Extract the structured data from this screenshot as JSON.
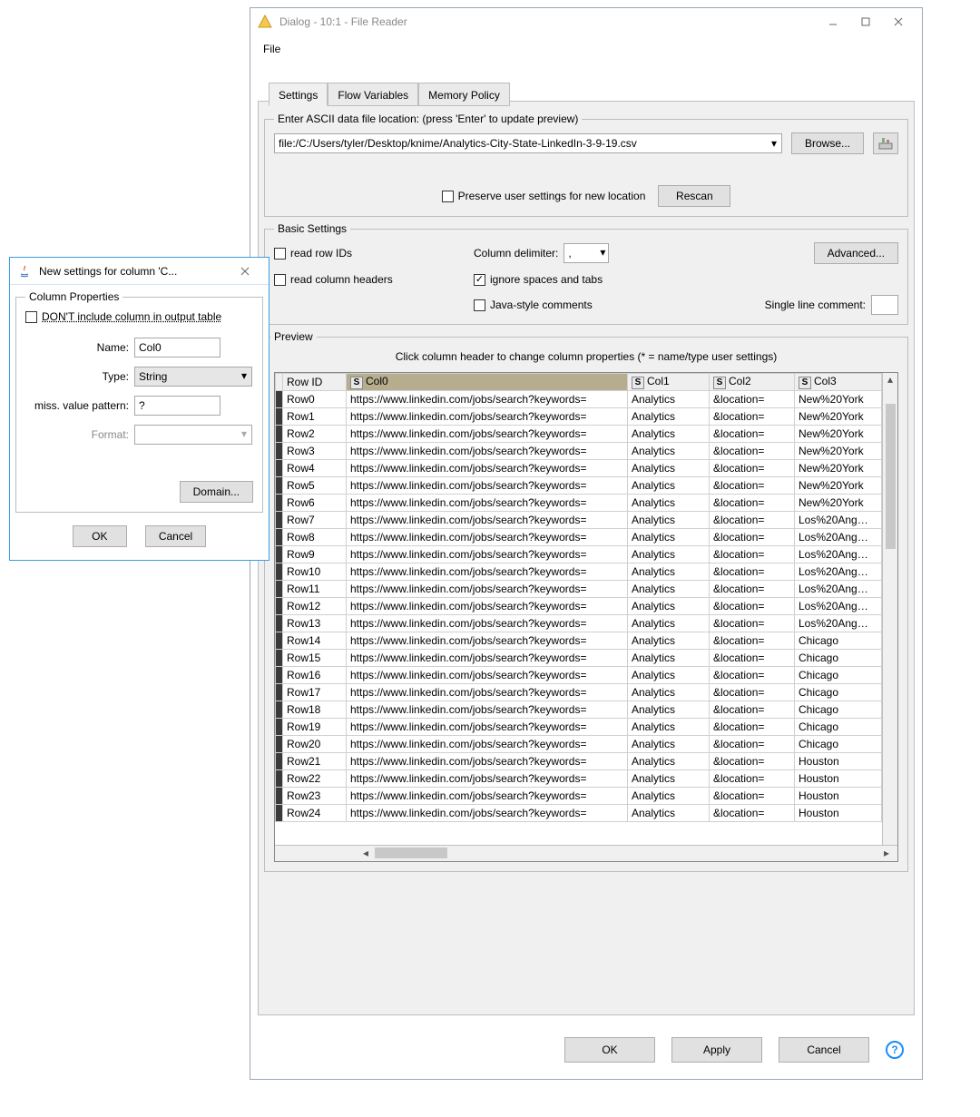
{
  "main": {
    "title": "Dialog - 10:1 - File Reader",
    "menu": {
      "file": "File"
    },
    "tabs": [
      "Settings",
      "Flow Variables",
      "Memory Policy"
    ],
    "location": {
      "legend": "Enter ASCII data file location: (press 'Enter' to update preview)",
      "path": "file:/C:/Users/tyler/Desktop/knime/Analytics-City-State-LinkedIn-3-9-19.csv",
      "browse": "Browse...",
      "preserve": "Preserve user settings for new location",
      "rescan": "Rescan"
    },
    "basic": {
      "legend": "Basic Settings",
      "readRowIds": "read row IDs",
      "readColHeaders": "read column headers",
      "colDelimLabel": "Column delimiter:",
      "colDelimValue": ",",
      "ignoreSpaces": "ignore spaces and tabs",
      "javaComments": "Java-style comments",
      "singleLine": "Single line comment:",
      "advanced": "Advanced..."
    },
    "preview": {
      "legend": "Preview",
      "hint": "Click column header to change column properties (* = name/type user settings)",
      "headers": {
        "rowid": "Row ID",
        "c0": "Col0",
        "c1": "Col1",
        "c2": "Col2",
        "c3": "Col3"
      },
      "rows": [
        {
          "id": "Row0",
          "c0": "https://www.linkedin.com/jobs/search?keywords=",
          "c1": "Analytics",
          "c2": "&location=",
          "c3": "New%20York"
        },
        {
          "id": "Row1",
          "c0": "https://www.linkedin.com/jobs/search?keywords=",
          "c1": "Analytics",
          "c2": "&location=",
          "c3": "New%20York"
        },
        {
          "id": "Row2",
          "c0": "https://www.linkedin.com/jobs/search?keywords=",
          "c1": "Analytics",
          "c2": "&location=",
          "c3": "New%20York"
        },
        {
          "id": "Row3",
          "c0": "https://www.linkedin.com/jobs/search?keywords=",
          "c1": "Analytics",
          "c2": "&location=",
          "c3": "New%20York"
        },
        {
          "id": "Row4",
          "c0": "https://www.linkedin.com/jobs/search?keywords=",
          "c1": "Analytics",
          "c2": "&location=",
          "c3": "New%20York"
        },
        {
          "id": "Row5",
          "c0": "https://www.linkedin.com/jobs/search?keywords=",
          "c1": "Analytics",
          "c2": "&location=",
          "c3": "New%20York"
        },
        {
          "id": "Row6",
          "c0": "https://www.linkedin.com/jobs/search?keywords=",
          "c1": "Analytics",
          "c2": "&location=",
          "c3": "New%20York"
        },
        {
          "id": "Row7",
          "c0": "https://www.linkedin.com/jobs/search?keywords=",
          "c1": "Analytics",
          "c2": "&location=",
          "c3": "Los%20Ang…"
        },
        {
          "id": "Row8",
          "c0": "https://www.linkedin.com/jobs/search?keywords=",
          "c1": "Analytics",
          "c2": "&location=",
          "c3": "Los%20Ang…"
        },
        {
          "id": "Row9",
          "c0": "https://www.linkedin.com/jobs/search?keywords=",
          "c1": "Analytics",
          "c2": "&location=",
          "c3": "Los%20Ang…"
        },
        {
          "id": "Row10",
          "c0": "https://www.linkedin.com/jobs/search?keywords=",
          "c1": "Analytics",
          "c2": "&location=",
          "c3": "Los%20Ang…"
        },
        {
          "id": "Row11",
          "c0": "https://www.linkedin.com/jobs/search?keywords=",
          "c1": "Analytics",
          "c2": "&location=",
          "c3": "Los%20Ang…"
        },
        {
          "id": "Row12",
          "c0": "https://www.linkedin.com/jobs/search?keywords=",
          "c1": "Analytics",
          "c2": "&location=",
          "c3": "Los%20Ang…"
        },
        {
          "id": "Row13",
          "c0": "https://www.linkedin.com/jobs/search?keywords=",
          "c1": "Analytics",
          "c2": "&location=",
          "c3": "Los%20Ang…"
        },
        {
          "id": "Row14",
          "c0": "https://www.linkedin.com/jobs/search?keywords=",
          "c1": "Analytics",
          "c2": "&location=",
          "c3": "Chicago"
        },
        {
          "id": "Row15",
          "c0": "https://www.linkedin.com/jobs/search?keywords=",
          "c1": "Analytics",
          "c2": "&location=",
          "c3": "Chicago"
        },
        {
          "id": "Row16",
          "c0": "https://www.linkedin.com/jobs/search?keywords=",
          "c1": "Analytics",
          "c2": "&location=",
          "c3": "Chicago"
        },
        {
          "id": "Row17",
          "c0": "https://www.linkedin.com/jobs/search?keywords=",
          "c1": "Analytics",
          "c2": "&location=",
          "c3": "Chicago"
        },
        {
          "id": "Row18",
          "c0": "https://www.linkedin.com/jobs/search?keywords=",
          "c1": "Analytics",
          "c2": "&location=",
          "c3": "Chicago"
        },
        {
          "id": "Row19",
          "c0": "https://www.linkedin.com/jobs/search?keywords=",
          "c1": "Analytics",
          "c2": "&location=",
          "c3": "Chicago"
        },
        {
          "id": "Row20",
          "c0": "https://www.linkedin.com/jobs/search?keywords=",
          "c1": "Analytics",
          "c2": "&location=",
          "c3": "Chicago"
        },
        {
          "id": "Row21",
          "c0": "https://www.linkedin.com/jobs/search?keywords=",
          "c1": "Analytics",
          "c2": "&location=",
          "c3": "Houston"
        },
        {
          "id": "Row22",
          "c0": "https://www.linkedin.com/jobs/search?keywords=",
          "c1": "Analytics",
          "c2": "&location=",
          "c3": "Houston"
        },
        {
          "id": "Row23",
          "c0": "https://www.linkedin.com/jobs/search?keywords=",
          "c1": "Analytics",
          "c2": "&location=",
          "c3": "Houston"
        },
        {
          "id": "Row24",
          "c0": "https://www.linkedin.com/jobs/search?keywords=",
          "c1": "Analytics",
          "c2": "&location=",
          "c3": "Houston"
        }
      ]
    },
    "footer": {
      "ok": "OK",
      "apply": "Apply",
      "cancel": "Cancel"
    }
  },
  "colDlg": {
    "title": "New settings for column 'C...",
    "legend": "Column Properties",
    "dontInclude": "DON'T include column in output table",
    "nameLabel": "Name:",
    "nameValue": "Col0",
    "typeLabel": "Type:",
    "typeValue": "String",
    "missLabel": "miss. value pattern:",
    "missValue": "?",
    "formatLabel": "Format:",
    "formatValue": "",
    "domain": "Domain...",
    "ok": "OK",
    "cancel": "Cancel"
  }
}
